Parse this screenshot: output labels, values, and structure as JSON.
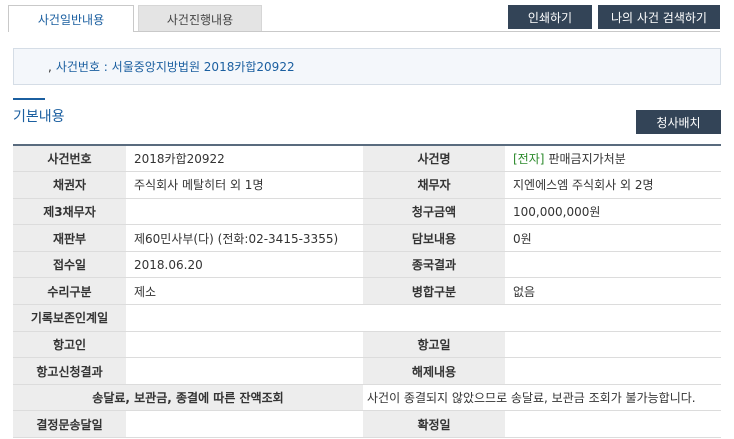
{
  "tabs": [
    {
      "label": "사건일반내용",
      "active": true
    },
    {
      "label": "사건진행내용",
      "active": false
    }
  ],
  "buttons": {
    "print": "인쇄하기",
    "my_case_search": "나의 사건 검색하기",
    "cheongsa": "청사배치"
  },
  "case_box": {
    "bullet": ",",
    "text": "사건번호 : 서울중앙지방법원 2018카합20922"
  },
  "section_title": "기본내용",
  "rows": [
    {
      "l1": "사건번호",
      "v1": "2018카합20922",
      "l2": "사건명",
      "v2_tag": "[전자]",
      "v2": "판매금지가처분"
    },
    {
      "l1": "채권자",
      "v1": "주식회사 메탈히터 외 1명",
      "l2": "채무자",
      "v2": "지엔에스엠 주식회사 외 2명"
    },
    {
      "l1": "제3채무자",
      "v1": "",
      "l2": "청구금액",
      "v2": "100,000,000원"
    },
    {
      "l1": "재판부",
      "v1": "제60민사부(다) (전화:02-3415-3355)",
      "l2": "담보내용",
      "v2": "0원"
    },
    {
      "l1": "접수일",
      "v1": "2018.06.20",
      "l2": "종국결과",
      "v2": ""
    },
    {
      "l1": "수리구분",
      "v1": "제소",
      "l2": "병합구분",
      "v2": "없음"
    },
    {
      "l1": "기록보존인계일",
      "v1": ""
    },
    {
      "l1": "항고인",
      "v1": "",
      "l2": "항고일",
      "v2": ""
    },
    {
      "l1": "항고신청결과",
      "v1": "",
      "l2": "해제내용",
      "v2": ""
    },
    {
      "l1": "송달료, 보관금, 종결에 따른 잔액조회",
      "v1": "사건이 종결되지 않았으므로 송달료, 보관금 조회가 불가능합니다."
    },
    {
      "l1": "결정문송달일",
      "v1": "",
      "l2": "확정일",
      "v2": ""
    }
  ]
}
